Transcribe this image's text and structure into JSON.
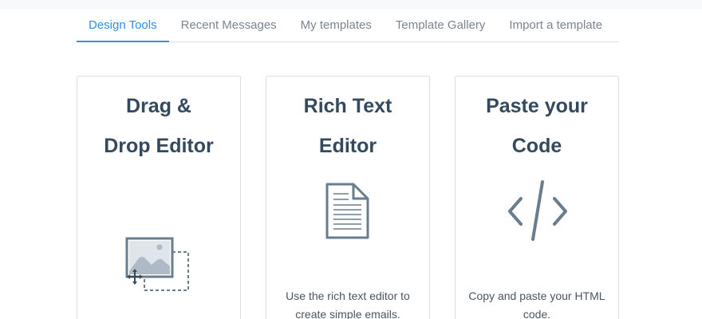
{
  "tabs": [
    {
      "label": "Design Tools",
      "active": true
    },
    {
      "label": "Recent Messages",
      "active": false
    },
    {
      "label": "My templates",
      "active": false
    },
    {
      "label": "Template Gallery",
      "active": false
    },
    {
      "label": "Import a template",
      "active": false
    }
  ],
  "cards": [
    {
      "title": "Drag & Drop Editor",
      "icon": "drag-drop-image-icon",
      "description": ""
    },
    {
      "title": "Rich Text Editor",
      "icon": "document-icon",
      "description": "Use the rich text editor to create simple emails."
    },
    {
      "title": "Paste your Code",
      "icon": "code-icon",
      "description": "Copy and paste your HTML code."
    }
  ],
  "colors": {
    "accent": "#2f8fe0",
    "icon": "#6a7d8d",
    "heading": "#34495e"
  }
}
